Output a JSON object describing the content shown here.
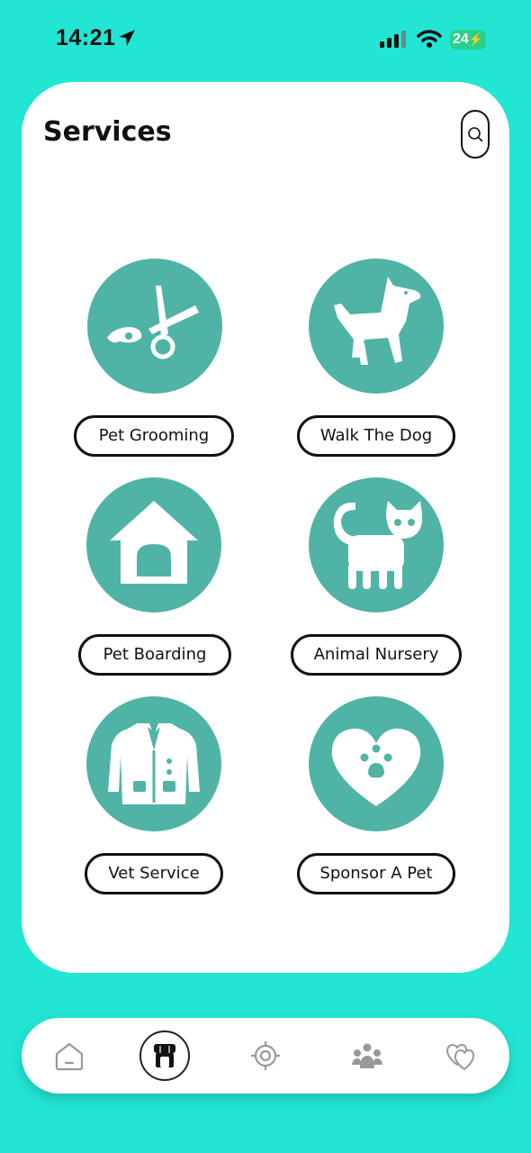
{
  "status_bar": {
    "time": "14:21",
    "battery": "24"
  },
  "header": {
    "title": "Services"
  },
  "services": [
    {
      "label": "Pet Grooming",
      "icon": "scissors-icon"
    },
    {
      "label": "Walk The Dog",
      "icon": "dog-icon"
    },
    {
      "label": "Pet Boarding",
      "icon": "dog-house-icon"
    },
    {
      "label": "Animal Nursery",
      "icon": "cat-icon"
    },
    {
      "label": "Vet Service",
      "icon": "vet-coat-icon"
    },
    {
      "label": "Sponsor A Pet",
      "icon": "heart-paw-icon"
    }
  ],
  "bottom_nav": [
    {
      "icon": "home-icon",
      "active": false
    },
    {
      "icon": "store-icon",
      "active": true
    },
    {
      "icon": "target-icon",
      "active": false
    },
    {
      "icon": "community-icon",
      "active": false
    },
    {
      "icon": "hearts-icon",
      "active": false
    }
  ],
  "colors": {
    "background": "#23e5d4",
    "accent": "#4fb3a6",
    "card": "#ffffff"
  }
}
